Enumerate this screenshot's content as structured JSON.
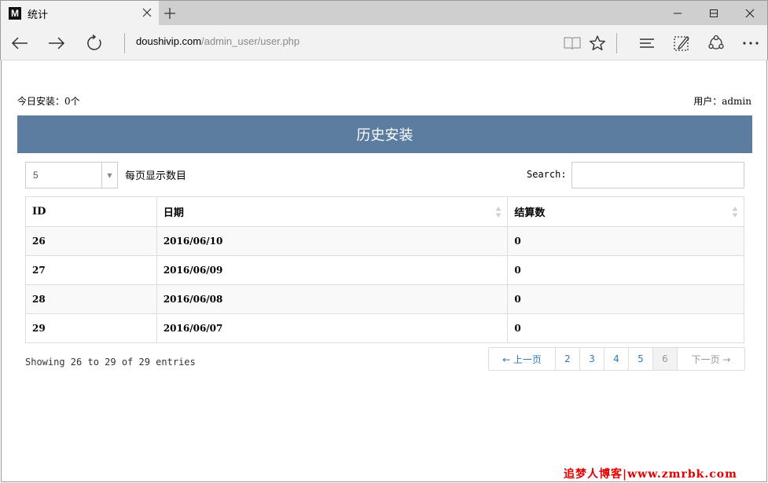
{
  "browser": {
    "tab_favicon": "M",
    "tab_title": "统计",
    "url_host": "doushivip.com",
    "url_path": "/admin_user/user.php"
  },
  "page": {
    "today_label": "今日安装：",
    "today_value": "0个",
    "user_label": "用户：",
    "user_value": "admin",
    "panel_title": "历史安装",
    "length_value": "5",
    "length_label": "每页显示数目",
    "search_label": "Search:",
    "search_value": "",
    "table": {
      "columns": [
        "ID",
        "日期",
        "结算数"
      ],
      "rows": [
        [
          "26",
          "2016/06/10",
          "0"
        ],
        [
          "27",
          "2016/06/09",
          "0"
        ],
        [
          "28",
          "2016/06/08",
          "0"
        ],
        [
          "29",
          "2016/06/07",
          "0"
        ]
      ]
    },
    "info": "Showing 26 to 29 of 29 entries",
    "pager": {
      "prev": "← 上一页",
      "pages": [
        "2",
        "3",
        "4",
        "5",
        "6"
      ],
      "active": "6",
      "next": "下一页 →"
    }
  },
  "watermark": "追梦人博客|www.zmrbk.com",
  "colors": {
    "panel_header": "#5c7da0",
    "link": "#337ab7",
    "watermark": "#e00000"
  }
}
